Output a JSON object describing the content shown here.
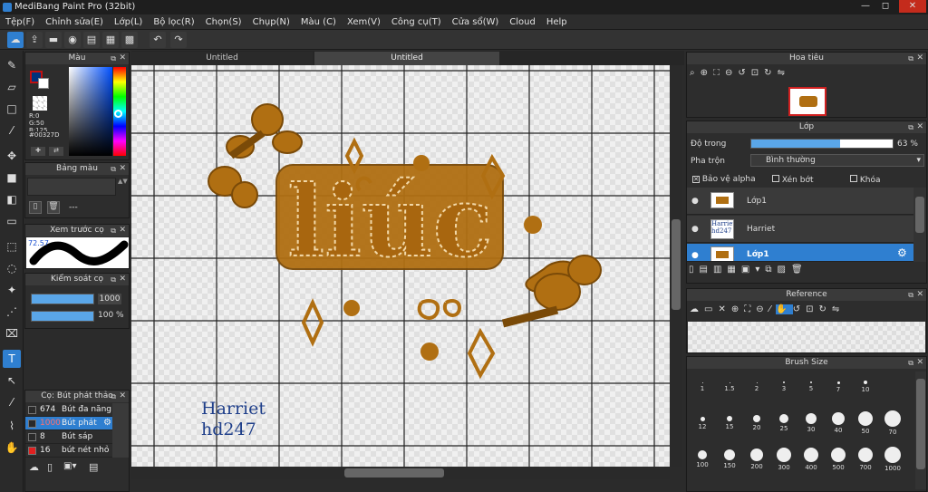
{
  "window": {
    "title": "MediBang Paint Pro (32bit)",
    "minimize": "—",
    "maximize": "◻",
    "close": "✕"
  },
  "menu": [
    "Tệp(F)",
    "Chỉnh sửa(E)",
    "Lớp(L)",
    "Bộ lọc(R)",
    "Chọn(S)",
    "Chụp(N)",
    "Màu (C)",
    "Xem(V)",
    "Công cụ(T)",
    "Cửa sổ(W)",
    "Cloud",
    "Help"
  ],
  "tabs": [
    "Untitled",
    "Untitled"
  ],
  "color_panel": {
    "title": "Màu",
    "r": "R:0",
    "g": "G:50",
    "b": "B:125",
    "hex": "#00327D",
    "fg": "#00327D"
  },
  "palette_panel": {
    "title": "Bảng màu",
    "value": "---"
  },
  "brush_preview": {
    "title": "Xem trước cọ",
    "value": "72.57"
  },
  "brush_control": {
    "title": "Kiểm soát cọ",
    "size": "1000",
    "opacity": "100 %",
    "size_fill": 1.0,
    "opacity_fill": 1.0
  },
  "brush_list": {
    "title": "Cọ: Bút phát thảo",
    "items": [
      {
        "size": "674",
        "name": "Bút đa năng",
        "color": "#2a2a2a"
      },
      {
        "size": "1000",
        "name": "Bút phát",
        "color": "#2a2a2a"
      },
      {
        "size": "8",
        "name": "Bút sáp",
        "color": "#2a2a2a"
      },
      {
        "size": "16",
        "name": "bút nét nhỏ",
        "color": "#e02020"
      }
    ]
  },
  "canvas": {
    "text1": "Harriet",
    "text2": "hd247",
    "lettering": "liúc"
  },
  "navigator": {
    "title": "Hoa tiêu"
  },
  "layers": {
    "title": "Lớp",
    "opacity_label": "Độ trong",
    "opacity_value": "63 %",
    "opacity_fill": 0.63,
    "blend_label": "Pha trộn",
    "blend_value": "Bình thường",
    "protect_alpha": "Bảo vệ alpha",
    "clipping": "Xén bớt",
    "lock": "Khóa",
    "items": [
      {
        "name": "Lớp1",
        "thumb": "lettering"
      },
      {
        "name": "Harriet",
        "thumb": "text"
      },
      {
        "name": "Lớp1",
        "thumb": "lettering",
        "selected": true
      }
    ],
    "thumb_text": "Harriet hd247"
  },
  "reference": {
    "title": "Reference"
  },
  "brush_size": {
    "title": "Brush Size",
    "sizes": [
      "1",
      "1.5",
      "2",
      "3",
      "5",
      "7",
      "10",
      "12",
      "15",
      "20",
      "25",
      "30",
      "40",
      "50",
      "70",
      "100",
      "150",
      "200",
      "300",
      "400",
      "500",
      "700",
      "1000"
    ]
  },
  "colors": {
    "accent": "#2f7fd0",
    "lettering": "#b06f12",
    "canvas_text": "#1f3f8a"
  }
}
